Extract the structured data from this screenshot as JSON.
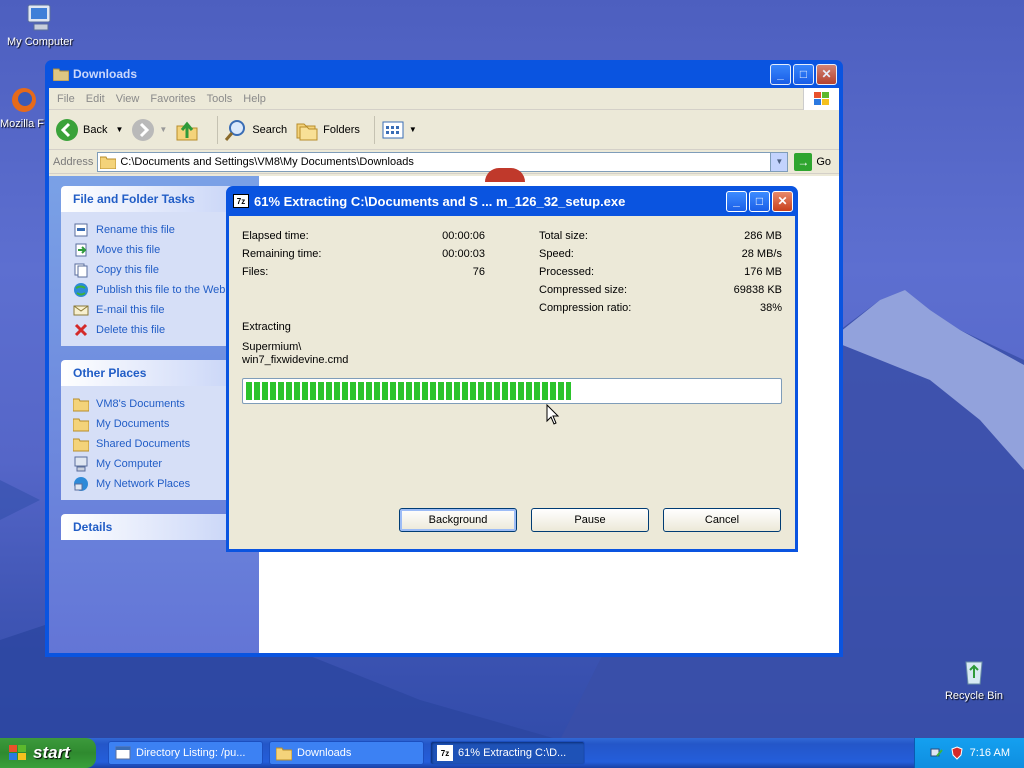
{
  "desktop": {
    "icons": [
      {
        "label": "My Computer"
      },
      {
        "label": "Mozilla F"
      },
      {
        "label": "Recycle Bin"
      }
    ]
  },
  "explorer": {
    "title": "Downloads",
    "menu": [
      "File",
      "Edit",
      "View",
      "Favorites",
      "Tools",
      "Help"
    ],
    "toolbar": {
      "back": "Back",
      "search": "Search",
      "folders": "Folders"
    },
    "address": {
      "label": "Address",
      "path": "C:\\Documents and Settings\\VM8\\My Documents\\Downloads",
      "go": "Go"
    },
    "file_tasks": {
      "title": "File and Folder Tasks",
      "items": [
        "Rename this file",
        "Move this file",
        "Copy this file",
        "Publish this file to the Web",
        "E-mail this file",
        "Delete this file"
      ]
    },
    "other_places": {
      "title": "Other Places",
      "items": [
        "VM8's Documents",
        "My Documents",
        "Shared Documents",
        "My Computer",
        "My Network Places"
      ]
    },
    "details": {
      "title": "Details"
    }
  },
  "dialog": {
    "title": "61% Extracting C:\\Documents and S ... m_126_32_setup.exe",
    "progress_fraction": 0.61,
    "left_stats": [
      {
        "label": "Elapsed time:",
        "value": "00:00:06"
      },
      {
        "label": "Remaining time:",
        "value": "00:00:03"
      },
      {
        "label": "Files:",
        "value": "76"
      }
    ],
    "right_stats": [
      {
        "label": "Total size:",
        "value": "286 MB"
      },
      {
        "label": "Speed:",
        "value": "28 MB/s"
      },
      {
        "label": "Processed:",
        "value": "176 MB"
      },
      {
        "label": "Compressed size:",
        "value": "69838 KB"
      },
      {
        "label": "Compression ratio:",
        "value": "38%"
      }
    ],
    "status": "Extracting",
    "current_dir": "Supermium\\",
    "current_file": "win7_fixwidevine.cmd",
    "buttons": {
      "background": "Background",
      "pause": "Pause",
      "cancel": "Cancel"
    }
  },
  "taskbar": {
    "start": "start",
    "tasks": [
      "Directory Listing: /pu...",
      "Downloads",
      "61% Extracting C:\\D..."
    ],
    "clock": "7:16 AM"
  }
}
